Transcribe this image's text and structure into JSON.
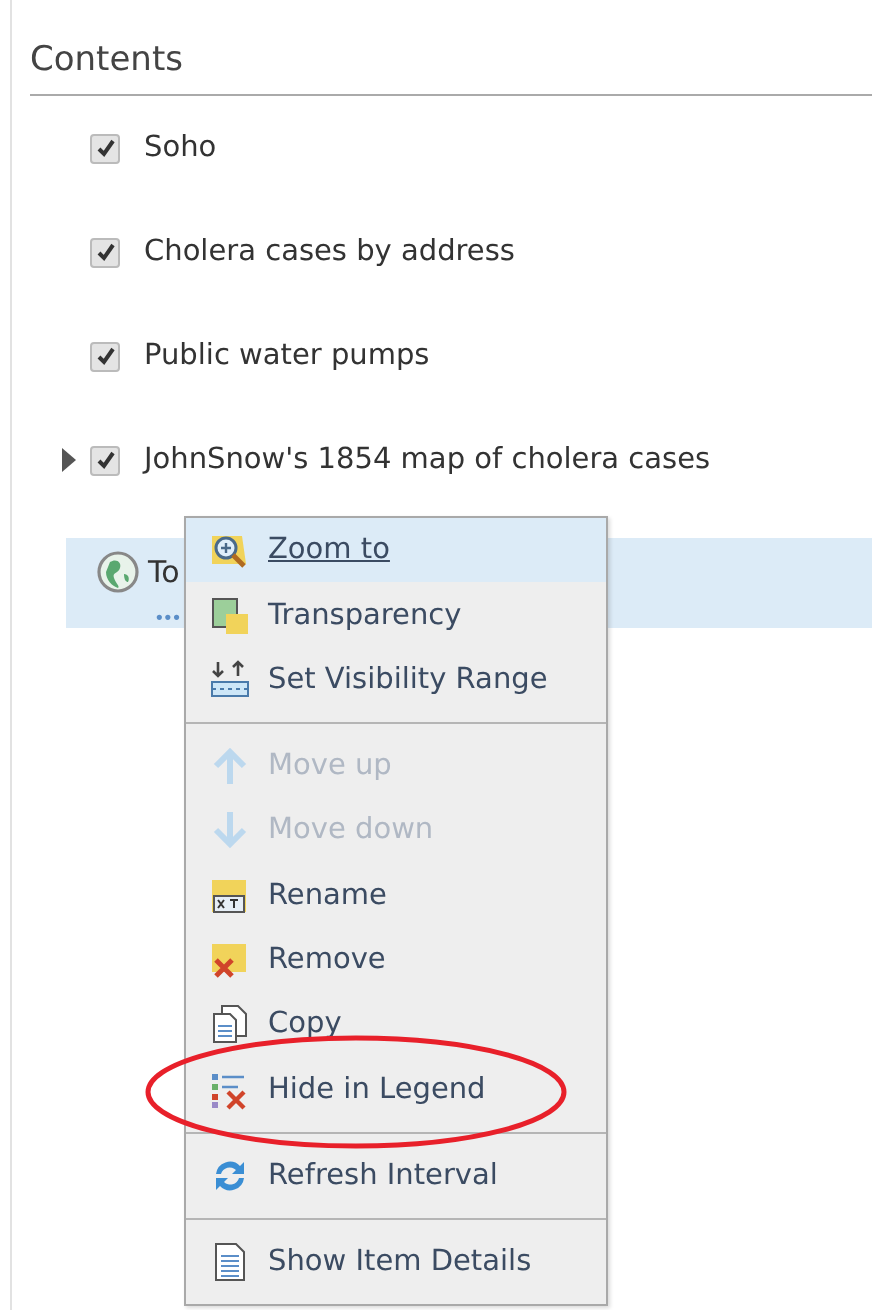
{
  "panel": {
    "title": "Contents"
  },
  "layers": [
    {
      "label": "Soho",
      "checked": true,
      "expandable": false
    },
    {
      "label": "Cholera cases by address",
      "checked": true,
      "expandable": false
    },
    {
      "label": "Public water pumps",
      "checked": true,
      "expandable": false
    },
    {
      "label": "JohnSnow's 1854 map of cholera cases",
      "checked": true,
      "expandable": true
    }
  ],
  "selected_layer": {
    "label": "To",
    "more": "•••"
  },
  "context_menu": {
    "groups": [
      [
        {
          "label": "Zoom to",
          "kind": "zoom",
          "selected": true,
          "disabled": false
        },
        {
          "label": "Transparency",
          "kind": "transparency",
          "selected": false,
          "disabled": false
        },
        {
          "label": "Set Visibility Range",
          "kind": "range",
          "selected": false,
          "disabled": false
        }
      ],
      [
        {
          "label": "Move up",
          "kind": "up",
          "selected": false,
          "disabled": true
        },
        {
          "label": "Move down",
          "kind": "down",
          "selected": false,
          "disabled": true
        },
        {
          "label": "Rename",
          "kind": "rename",
          "selected": false,
          "disabled": false
        },
        {
          "label": "Remove",
          "kind": "remove",
          "selected": false,
          "disabled": false
        },
        {
          "label": "Copy",
          "kind": "copy",
          "selected": false,
          "disabled": false
        },
        {
          "label": "Hide in Legend",
          "kind": "legend",
          "selected": false,
          "disabled": false
        }
      ],
      [
        {
          "label": "Refresh Interval",
          "kind": "refresh",
          "selected": false,
          "disabled": false
        }
      ],
      [
        {
          "label": "Show Item Details",
          "kind": "details",
          "selected": false,
          "disabled": false
        }
      ]
    ]
  },
  "annotations": [
    {
      "kind": "ellipse"
    }
  ]
}
